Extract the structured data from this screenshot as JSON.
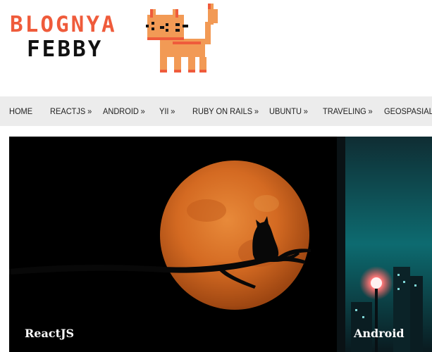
{
  "site": {
    "logo_line1": "BLOGNYA",
    "logo_line2": "FEBBY",
    "logo_accent": "#ef5b3b"
  },
  "nav": {
    "items": [
      {
        "label": "HOME",
        "has_submenu": false
      },
      {
        "label": "REACTJS",
        "has_submenu": true
      },
      {
        "label": "ANDROID",
        "has_submenu": true
      },
      {
        "label": "YII",
        "has_submenu": true
      },
      {
        "label": "RUBY ON RAILS",
        "has_submenu": true
      },
      {
        "label": "UBUNTU",
        "has_submenu": true
      },
      {
        "label": "TRAVELING",
        "has_submenu": true
      },
      {
        "label": "GEOSPASIAL",
        "has_submenu": true
      }
    ],
    "submenu_indicator": "»"
  },
  "slider": {
    "slides": [
      {
        "caption": "ReactJS"
      },
      {
        "caption": "Android"
      }
    ]
  }
}
